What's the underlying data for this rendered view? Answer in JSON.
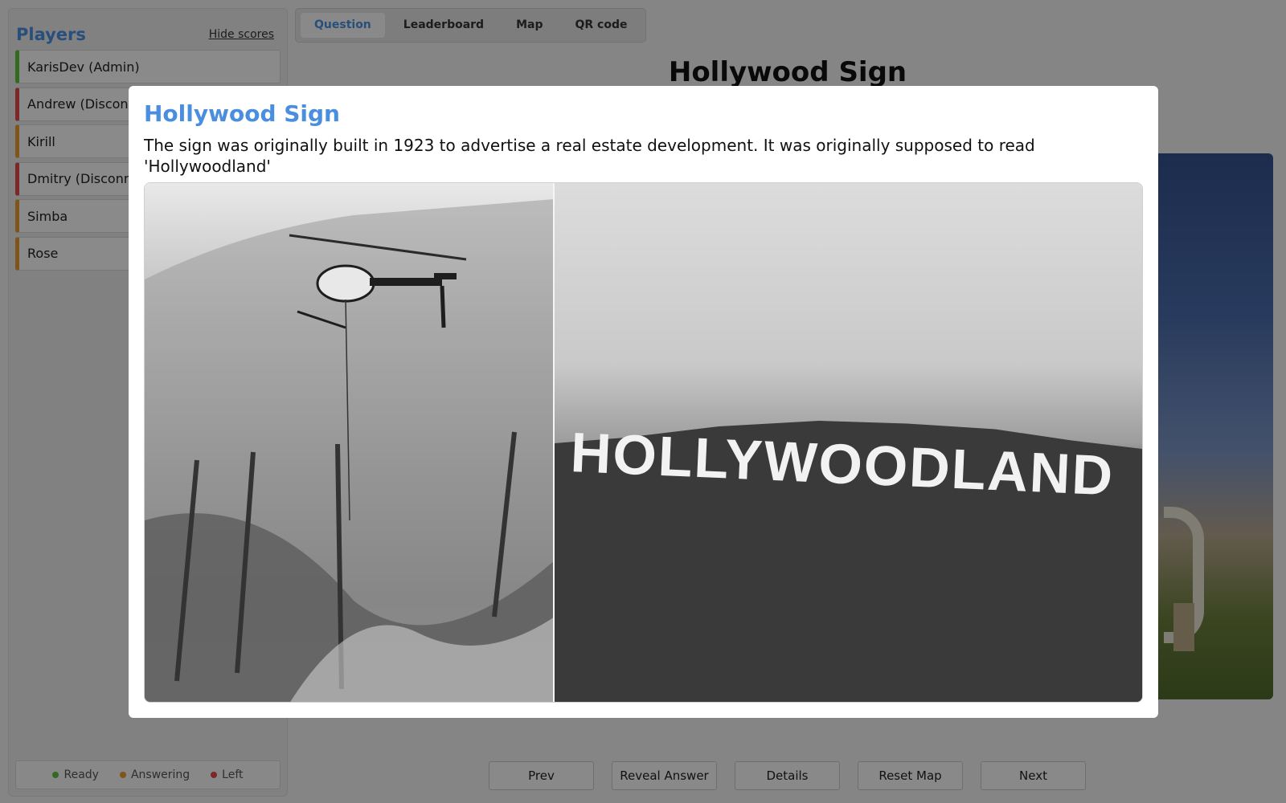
{
  "sidebar": {
    "title": "Players",
    "hide_scores": "Hide scores",
    "players": [
      {
        "name": "KarisDev (Admin)",
        "status": "ready"
      },
      {
        "name": "Andrew (Disconnected)",
        "status": "left"
      },
      {
        "name": "Kirill",
        "status": "answering"
      },
      {
        "name": "Dmitry (Disconnected)",
        "status": "left"
      },
      {
        "name": "Simba",
        "status": "answering"
      },
      {
        "name": "Rose",
        "status": "answering"
      }
    ],
    "legend": {
      "ready": "Ready",
      "answering": "Answering",
      "left": "Left"
    }
  },
  "tabs": {
    "question": "Question",
    "leaderboard": "Leaderboard",
    "map": "Map",
    "qr": "QR code"
  },
  "main": {
    "question_title": "Hollywood Sign"
  },
  "actions": {
    "prev": "Prev",
    "reveal": "Reveal Answer",
    "details": "Details",
    "reset_map": "Reset Map",
    "next": "Next"
  },
  "modal": {
    "title": "Hollywood Sign",
    "text": "The sign was originally built in 1923 to advertise a real estate development. It was originally supposed to read 'Hollywoodland'",
    "sign_text": "HOLLYWOODLAND"
  },
  "colors": {
    "accent": "#4a8ee0",
    "ready": "#5cc23f",
    "answering": "#e79b2e",
    "left": "#e04a4a"
  }
}
